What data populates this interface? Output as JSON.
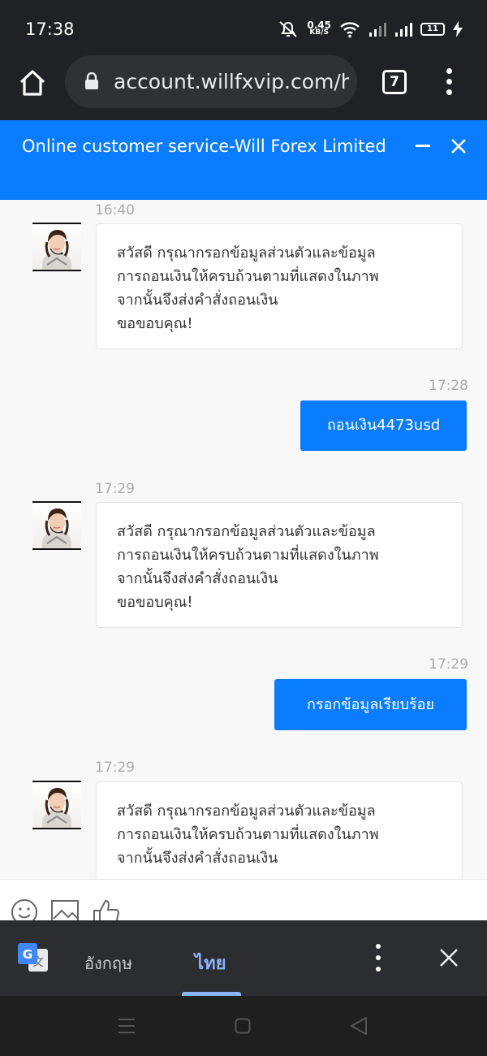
{
  "status_bar": {
    "time": "17:38",
    "net_speed_value": "0.45",
    "net_speed_unit": "KB/S",
    "battery": "11"
  },
  "browser": {
    "url": "account.willfxvip.com/h",
    "tab_count": "7"
  },
  "chat": {
    "title": "Online customer service-Will Forex Limited",
    "accent_color": "#0a7cff",
    "messages": [
      {
        "direction": "incoming",
        "time": "16:40",
        "text": "สวัสดี กรุณากรอกข้อมูลส่วนตัวและข้อมูล\nการถอนเงินให้ครบถ้วนตามที่แสดงในภาพ\nจากนั้นจึงส่งคำสั่งถอนเงิน\nขอขอบคุณ!"
      },
      {
        "direction": "outgoing",
        "time": "17:28",
        "text": "ถอนเงิน4473usd"
      },
      {
        "direction": "incoming",
        "time": "17:29",
        "text": "สวัสดี กรุณากรอกข้อมูลส่วนตัวและข้อมูล\nการถอนเงินให้ครบถ้วนตามที่แสดงในภาพ\nจากนั้นจึงส่งคำสั่งถอนเงิน\nขอขอบคุณ!"
      },
      {
        "direction": "outgoing",
        "time": "17:29",
        "text": "กรอกข้อมูลเรียบร้อย"
      },
      {
        "direction": "incoming",
        "time": "17:29",
        "text": "สวัสดี กรุณากรอกข้อมูลส่วนตัวและข้อมูล\nการถอนเงินให้ครบถ้วนตามที่แสดงในภาพ\nจากนั้นจึงส่งคำสั่งถอนเงิน"
      }
    ]
  },
  "translate_bar": {
    "source_lang": "อังกฤษ",
    "target_lang": "ไทย",
    "active": "target"
  },
  "icons": [
    "home-icon",
    "lock-icon",
    "tabs-icon",
    "more-vert-icon",
    "minimize-icon",
    "close-icon",
    "emoji-icon",
    "image-icon",
    "thumbs-up-icon",
    "google-translate-icon",
    "recent-apps-icon",
    "home-nav-icon",
    "back-icon"
  ]
}
